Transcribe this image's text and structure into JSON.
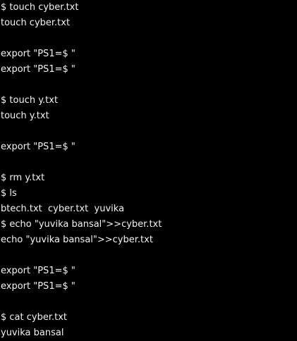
{
  "terminal": {
    "lines": [
      "$ touch cyber.txt",
      "touch cyber.txt",
      "",
      "export \"PS1=$ \"",
      "export \"PS1=$ \"",
      "",
      "$ touch y.txt",
      "touch y.txt",
      "",
      "export \"PS1=$ \"",
      "",
      "$ rm y.txt",
      "$ ls",
      "btech.txt  cyber.txt  yuvika",
      "$ echo \"yuvika bansal\">>cyber.txt",
      "echo \"yuvika bansal\">>cyber.txt",
      "",
      "export \"PS1=$ \"",
      "export \"PS1=$ \"",
      "",
      "$ cat cyber.txt",
      "yuvika bansal"
    ]
  },
  "colors": {
    "background": "#000000",
    "foreground": "#f2f2f2"
  }
}
